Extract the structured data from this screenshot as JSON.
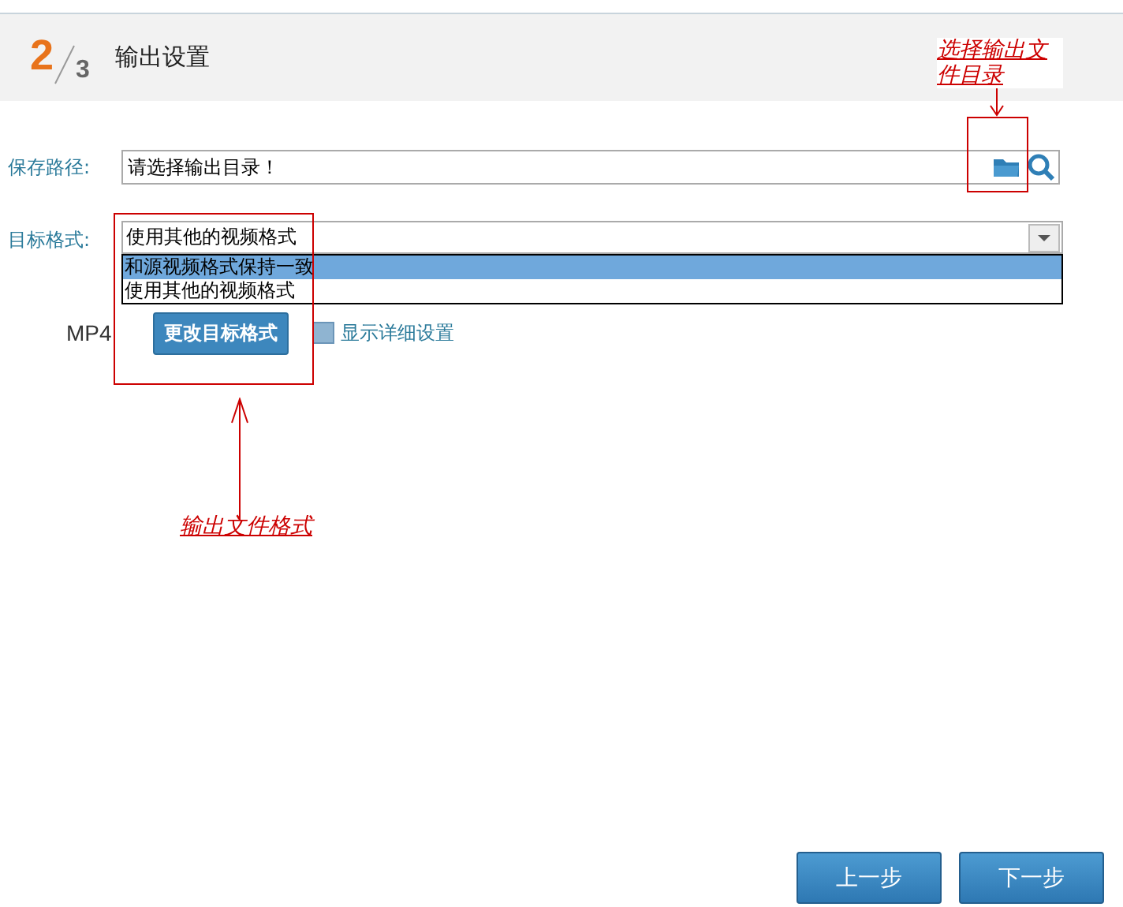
{
  "header": {
    "step": "2",
    "total": "3",
    "title": "输出设置"
  },
  "save_path": {
    "label": "保存路径:",
    "value": "请选择输出目录！"
  },
  "target_format": {
    "label": "目标格式:",
    "value": "使用其他的视频格式",
    "expanded": true,
    "options": [
      {
        "label": "和源视频格式保持一致",
        "highlighted": true
      },
      {
        "label": "使用其他的视频格式",
        "highlighted": false
      }
    ]
  },
  "format_name": "MP4",
  "change_button": "更改目标格式",
  "detail_checkbox": {
    "label": "显示详细设置",
    "checked": false
  },
  "annotations": [
    {
      "text": "选择输出文件目录"
    },
    {
      "text": "输出文件格式"
    }
  ],
  "buttons": [
    {
      "label": "上一步"
    },
    {
      "label": "下一步"
    }
  ]
}
